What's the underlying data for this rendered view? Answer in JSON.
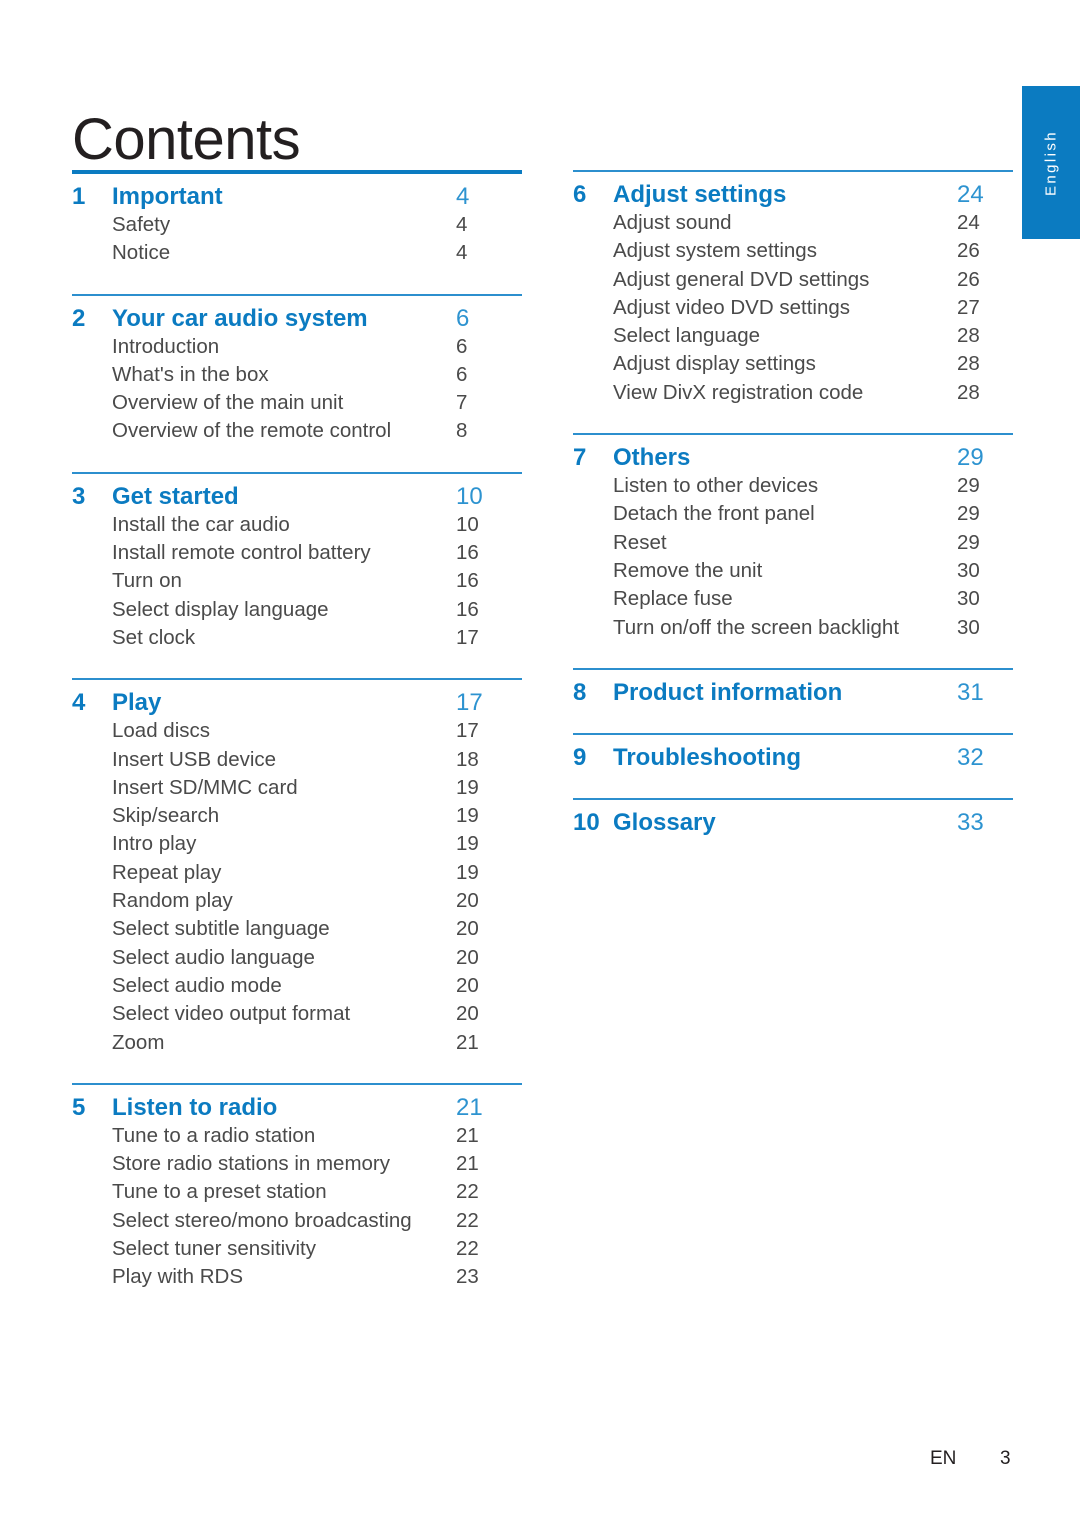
{
  "page": {
    "title": "Contents",
    "language_tab": "English",
    "footer_language_code": "EN",
    "footer_page_number": "3",
    "accent_color": "#0b7bc1",
    "rule_color": "#2c8fce",
    "body_text_color": "#4a4a4a"
  },
  "columns": [
    {
      "id": "left",
      "sections": [
        {
          "number": "1",
          "title": "Important",
          "page": "4",
          "rule": "thick",
          "entries": [
            {
              "title": "Safety",
              "page": "4"
            },
            {
              "title": "Notice",
              "page": "4"
            }
          ]
        },
        {
          "number": "2",
          "title": "Your car audio system",
          "page": "6",
          "rule": "thin",
          "entries": [
            {
              "title": "Introduction",
              "page": "6"
            },
            {
              "title": "What's in the box",
              "page": "6"
            },
            {
              "title": "Overview of the main unit",
              "page": "7"
            },
            {
              "title": "Overview of the remote control",
              "page": "8"
            }
          ]
        },
        {
          "number": "3",
          "title": "Get started",
          "page": "10",
          "rule": "thin",
          "entries": [
            {
              "title": "Install the car audio",
              "page": "10"
            },
            {
              "title": "Install remote control battery",
              "page": "16"
            },
            {
              "title": "Turn on",
              "page": "16"
            },
            {
              "title": "Select display language",
              "page": "16"
            },
            {
              "title": "Set clock",
              "page": "17"
            }
          ]
        },
        {
          "number": "4",
          "title": "Play",
          "page": "17",
          "rule": "thin",
          "entries": [
            {
              "title": "Load discs",
              "page": "17"
            },
            {
              "title": "Insert USB device",
              "page": "18"
            },
            {
              "title": "Insert SD/MMC card",
              "page": "19"
            },
            {
              "title": "Skip/search",
              "page": "19"
            },
            {
              "title": "Intro play",
              "page": "19"
            },
            {
              "title": "Repeat play",
              "page": "19"
            },
            {
              "title": "Random play",
              "page": "20"
            },
            {
              "title": "Select subtitle language",
              "page": "20"
            },
            {
              "title": "Select audio language",
              "page": "20"
            },
            {
              "title": "Select audio mode",
              "page": "20"
            },
            {
              "title": "Select video output format",
              "page": "20"
            },
            {
              "title": "Zoom",
              "page": "21"
            }
          ]
        },
        {
          "number": "5",
          "title": "Listen to radio",
          "page": "21",
          "rule": "thin",
          "entries": [
            {
              "title": "Tune to a radio station",
              "page": "21"
            },
            {
              "title": "Store radio stations in memory",
              "page": "21"
            },
            {
              "title": "Tune to a preset station",
              "page": "22"
            },
            {
              "title": "Select stereo/mono broadcasting",
              "page": "22"
            },
            {
              "title": "Select tuner sensitivity",
              "page": "22"
            },
            {
              "title": "Play with RDS",
              "page": "23"
            }
          ]
        }
      ]
    },
    {
      "id": "right",
      "sections": [
        {
          "number": "6",
          "title": "Adjust settings",
          "page": "24",
          "rule": "thin",
          "entries": [
            {
              "title": "Adjust sound",
              "page": "24"
            },
            {
              "title": "Adjust system settings",
              "page": "26"
            },
            {
              "title": "Adjust general DVD settings",
              "page": "26"
            },
            {
              "title": "Adjust video DVD settings",
              "page": "27"
            },
            {
              "title": "Select language",
              "page": "28"
            },
            {
              "title": "Adjust display settings",
              "page": "28"
            },
            {
              "title": "View DivX registration code",
              "page": "28"
            }
          ]
        },
        {
          "number": "7",
          "title": "Others",
          "page": "29",
          "rule": "thin",
          "entries": [
            {
              "title": "Listen to other devices",
              "page": "29"
            },
            {
              "title": "Detach the front panel",
              "page": "29"
            },
            {
              "title": "Reset",
              "page": "29"
            },
            {
              "title": "Remove the unit",
              "page": "30"
            },
            {
              "title": "Replace fuse",
              "page": "30"
            },
            {
              "title": "Turn on/off the screen backlight",
              "page": "30"
            }
          ]
        },
        {
          "number": "8",
          "title": "Product information",
          "page": "31",
          "rule": "thin",
          "entries": []
        },
        {
          "number": "9",
          "title": "Troubleshooting",
          "page": "32",
          "rule": "thin",
          "entries": []
        },
        {
          "number": "10",
          "title": "Glossary",
          "page": "33",
          "rule": "thin",
          "entries": []
        }
      ]
    }
  ]
}
